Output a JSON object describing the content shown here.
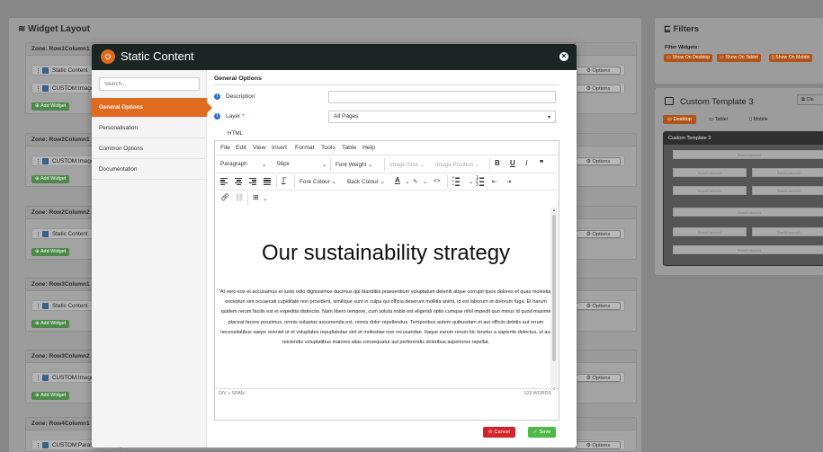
{
  "background": {
    "layout_title": "Widget Layout",
    "zones": [
      {
        "title": "Zone: Row1Column1",
        "rows": [
          "Static Content",
          "CUSTOM:Image"
        ]
      },
      {
        "title": "Zone: Row2Column1",
        "rows": [
          "CUSTOM:Image"
        ]
      },
      {
        "title": "Zone: Row2Column2",
        "rows": [
          "Static Content"
        ]
      },
      {
        "title": "Zone: Row3Column1",
        "rows": [
          "Static Content"
        ]
      },
      {
        "title": "Zone: Row3Column2",
        "rows": [
          "CUSTOM:Image"
        ]
      },
      {
        "title": "Zone: Row4Column1",
        "rows": [
          "CUSTOM:Parallax Scrolling Area"
        ]
      }
    ],
    "add_widget_label": "Add Widget",
    "options_label": "Options",
    "filters": {
      "title": "Filters",
      "filter_widgets_label": "Filter Widgets:",
      "buttons": [
        "Show On Desktop",
        "Show On Tablet",
        "Show On Mobile"
      ]
    },
    "template": {
      "title": "Custom Template 3",
      "clone_label": "Clo",
      "tabs": [
        "Desktop",
        "Tablet",
        "Mobile"
      ],
      "preview_title": "Custom Template 3",
      "preview_cells": [
        "Row1Column1",
        "Row2Column1",
        "Row2Column2",
        "Row3Column1",
        "Row3Column2",
        "Row4Column1",
        "Row5Column1",
        "Row5Column2",
        "Row6Column1"
      ]
    }
  },
  "modal": {
    "title": "Static Content",
    "search_placeholder": "Search...",
    "sidebar": [
      "General Options",
      "Personalisation",
      "Common Options",
      "Documentation"
    ],
    "section_title": "General Options",
    "description_label": "Description",
    "description_value": "",
    "layer_label": "Layer",
    "layer_value": "All Pages",
    "html_label": "HTML",
    "menu": [
      "File",
      "Edit",
      "View",
      "Insert",
      "Format",
      "Tools",
      "Table",
      "Help"
    ],
    "toolbar": {
      "block_format": "Paragraph",
      "font_size": "56px",
      "font_weight": "Font Weight",
      "image_size": "Image Size",
      "image_position": "Image Position",
      "fore_colour": "Fore Colour",
      "back_colour": "Back Colour"
    },
    "doc_heading": "Our sustainability strategy",
    "doc_body": "\"At vero eos et accusamus et iusto odio dignissimos ducimus qui blanditiis praesentium voluptatum deleniti atque corrupti quos dolores et quas molestias excepturi sint occaecati cupiditate non provident, similique sunt in culpa qui officia deserunt mollitia animi, id est laborum et dolorum fuga. Et harum quidem rerum facilis est et expedita distinctio. Nam libero tempore, cum soluta nobis est eligendi optio cumque nihil impedit quo minus id quod maxime placeat facere possimus, omnis voluptas assumenda est, omnis dolor repellendus. Temporibus autem quibusdam et aut officiis debitis aut rerum necessitatibus saepe eveniet ut et voluptates repudiandae sint et molestiae non recusandae. Itaque earum rerum hic tenetur a sapiente delectus, ut aut reiciendis voluptatibus maiores alias consequatur aut perferendis doloribus asperiores repellat.",
    "status_path": "DIV » SPAN",
    "word_count": "123 WORDS",
    "cancel_label": "Cancel",
    "save_label": "Save"
  }
}
